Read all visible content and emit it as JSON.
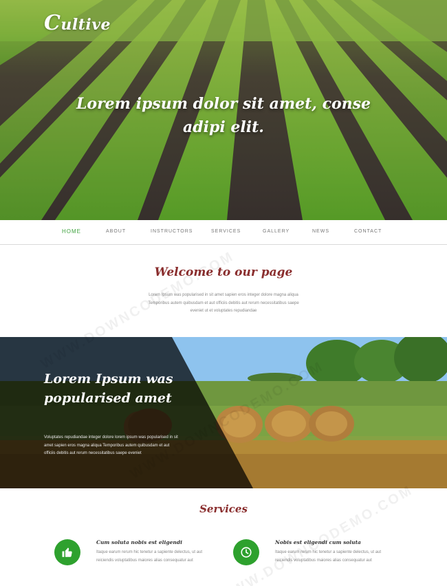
{
  "brand": {
    "logo_cap": "C",
    "logo_rest": "ultive"
  },
  "hero": {
    "headline": "Lorem ipsum dolor sit amet, conse adipi elit."
  },
  "nav": {
    "items": [
      {
        "label": "HOME",
        "active": true
      },
      {
        "label": "ABOUT",
        "active": false
      },
      {
        "label": "INSTRUCTORS",
        "active": false
      },
      {
        "label": "SERVICES",
        "active": false
      },
      {
        "label": "GALLERY",
        "active": false
      },
      {
        "label": "NEWS",
        "active": false
      },
      {
        "label": "CONTACT",
        "active": false
      }
    ]
  },
  "welcome": {
    "title": "Welcome to our page",
    "text": "Lorem Ipsum was popularised in sit amet sapien eros integer dolore magna aliqua Temporibus autem quibusdam et aut officiis debitis aut rerum necessitatibus saepe eveniet ut et voluptates repudiandae"
  },
  "banner": {
    "title": "Lorem Ipsum was popularised amet",
    "text": "Voluptates repudiandae integer dolore lorem ipsum was popularised in sit amet sapien eros magna aliqua Temporibus autem quibusdam et aut officiis debitis aut rerum necessitatibus saepe eveniet"
  },
  "services": {
    "title": "Services",
    "items": [
      {
        "icon": "thumbs-up-icon",
        "title": "Cum soluta nobis est eligendi",
        "text": "Itaque earum rerum hic tenetur a sapiente delectus, ut aut reiciendis voluptatibus maiores alias consequatur aut"
      },
      {
        "icon": "clock-icon",
        "title": "Nobis est eligendi cum soluta",
        "text": "Itaque earum rerum hic tenetur a sapiente delectus, ut aut reiciendis voluptatibus maiores alias consequatur aut"
      }
    ]
  },
  "watermark": {
    "text": "WWW.DOWNCODEMO.COM"
  },
  "colors": {
    "accent_green": "#2ea12e",
    "heading_red": "#8a2e2e"
  }
}
